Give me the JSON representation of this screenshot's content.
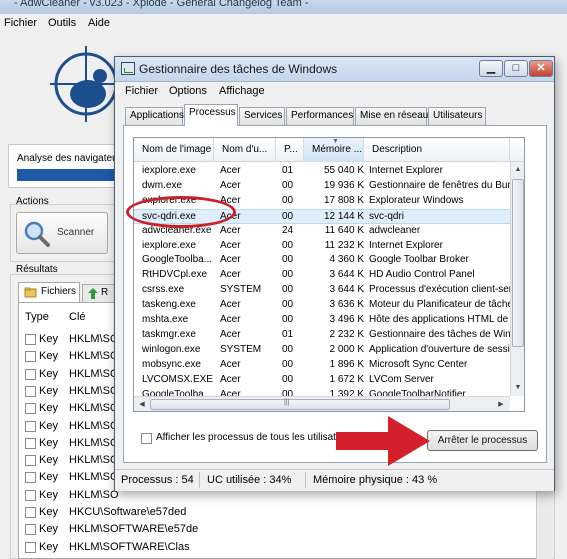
{
  "adw": {
    "title": "- AdwCleaner - v3.023 - Xplode - Général Changelog Team -",
    "menu": [
      "Fichier",
      "Outils",
      "Aide"
    ],
    "analyse_label": "Analyse des navigateur",
    "actions_label": "Actions",
    "scan_label": "Scanner",
    "results_label": "Résultats",
    "tab_files": "Fichiers",
    "tab_reg": "R",
    "col_type": "Type",
    "col_key": "Clé",
    "rows": [
      {
        "type": "Key",
        "key": "HKLM\\SO"
      },
      {
        "type": "Key",
        "key": "HKLM\\SO"
      },
      {
        "type": "Key",
        "key": "HKLM\\SO"
      },
      {
        "type": "Key",
        "key": "HKLM\\SO"
      },
      {
        "type": "Key",
        "key": "HKLM\\SO"
      },
      {
        "type": "Key",
        "key": "HKLM\\SO"
      },
      {
        "type": "Key",
        "key": "HKLM\\SO"
      },
      {
        "type": "Key",
        "key": "HKLM\\SO"
      },
      {
        "type": "Key",
        "key": "HKLM\\SO"
      },
      {
        "type": "Key",
        "key": "HKLM\\SO"
      },
      {
        "type": "Key",
        "key": "HKCU\\Software\\e57ded"
      },
      {
        "type": "Key",
        "key": "HKLM\\SOFTWARE\\e57de"
      },
      {
        "type": "Key",
        "key": "HKLM\\SOFTWARE\\Clas"
      }
    ]
  },
  "tm": {
    "title": "Gestionnaire des tâches de Windows",
    "menu": [
      "Fichier",
      "Options",
      "Affichage"
    ],
    "tabs": [
      "Applications",
      "Processus",
      "Services",
      "Performances",
      "Mise en réseau",
      "Utilisateurs"
    ],
    "active_tab": "Processus",
    "columns": [
      "Nom de l'image",
      "Nom d'u...",
      "P...",
      "Mémoire ...",
      "Description"
    ],
    "processes": [
      {
        "name": "iexplore.exe",
        "user": "Acer",
        "cpu": "01",
        "mem": "55 040 K",
        "desc": "Internet Explorer"
      },
      {
        "name": "dwm.exe",
        "user": "Acer",
        "cpu": "00",
        "mem": "19 936 K",
        "desc": "Gestionnaire de fenêtres du Bureau"
      },
      {
        "name": "explorer.exe",
        "user": "Acer",
        "cpu": "00",
        "mem": "17 808 K",
        "desc": "Explorateur Windows"
      },
      {
        "name": "svc-qdri.exe",
        "user": "Acer",
        "cpu": "00",
        "mem": "12 144 K",
        "desc": "svc-qdri",
        "selected": true
      },
      {
        "name": "adwcleaner.exe",
        "user": "Acer",
        "cpu": "24",
        "mem": "11 640 K",
        "desc": "adwcleaner"
      },
      {
        "name": "iexplore.exe",
        "user": "Acer",
        "cpu": "00",
        "mem": "11 232 K",
        "desc": "Internet Explorer"
      },
      {
        "name": "GoogleToolba...",
        "user": "Acer",
        "cpu": "00",
        "mem": "4 360 K",
        "desc": "Google Toolbar Broker"
      },
      {
        "name": "RtHDVCpl.exe",
        "user": "Acer",
        "cpu": "00",
        "mem": "3 644 K",
        "desc": "HD Audio Control Panel"
      },
      {
        "name": "csrss.exe",
        "user": "SYSTEM",
        "cpu": "00",
        "mem": "3 644 K",
        "desc": "Processus d'exécution client-serve"
      },
      {
        "name": "taskeng.exe",
        "user": "Acer",
        "cpu": "00",
        "mem": "3 636 K",
        "desc": "Moteur du Planificateur de tâches"
      },
      {
        "name": "mshta.exe",
        "user": "Acer",
        "cpu": "00",
        "mem": "3 496 K",
        "desc": "Hôte des applications HTML de Micr"
      },
      {
        "name": "taskmgr.exe",
        "user": "Acer",
        "cpu": "01",
        "mem": "2 232 K",
        "desc": "Gestionnaire des tâches de Window"
      },
      {
        "name": "winlogon.exe",
        "user": "SYSTEM",
        "cpu": "00",
        "mem": "2 000 K",
        "desc": "Application d'ouverture de session"
      },
      {
        "name": "mobsync.exe",
        "user": "Acer",
        "cpu": "00",
        "mem": "1 896 K",
        "desc": "Microsoft Sync Center"
      },
      {
        "name": "LVCOMSX.EXE",
        "user": "Acer",
        "cpu": "00",
        "mem": "1 672 K",
        "desc": "LVCom Server"
      },
      {
        "name": "GoogleToolba...",
        "user": "Acer",
        "cpu": "00",
        "mem": "1 392 K",
        "desc": "GoogleToolbarNotifier"
      }
    ],
    "show_all_label": "Afficher les processus de tous les utilisateurs",
    "end_process_label": "Arrêter le processus",
    "status": {
      "processes": "Processus : 54",
      "cpu": "UC utilisée : 34%",
      "memory": "Mémoire physique : 43 %"
    },
    "window_buttons": {
      "min": "▁",
      "max": "□",
      "close": "✕"
    }
  },
  "colors": {
    "annotation_red": "#d4202a",
    "selection_blue": "#dfeefb",
    "progress_blue": "#1e5aa8"
  }
}
